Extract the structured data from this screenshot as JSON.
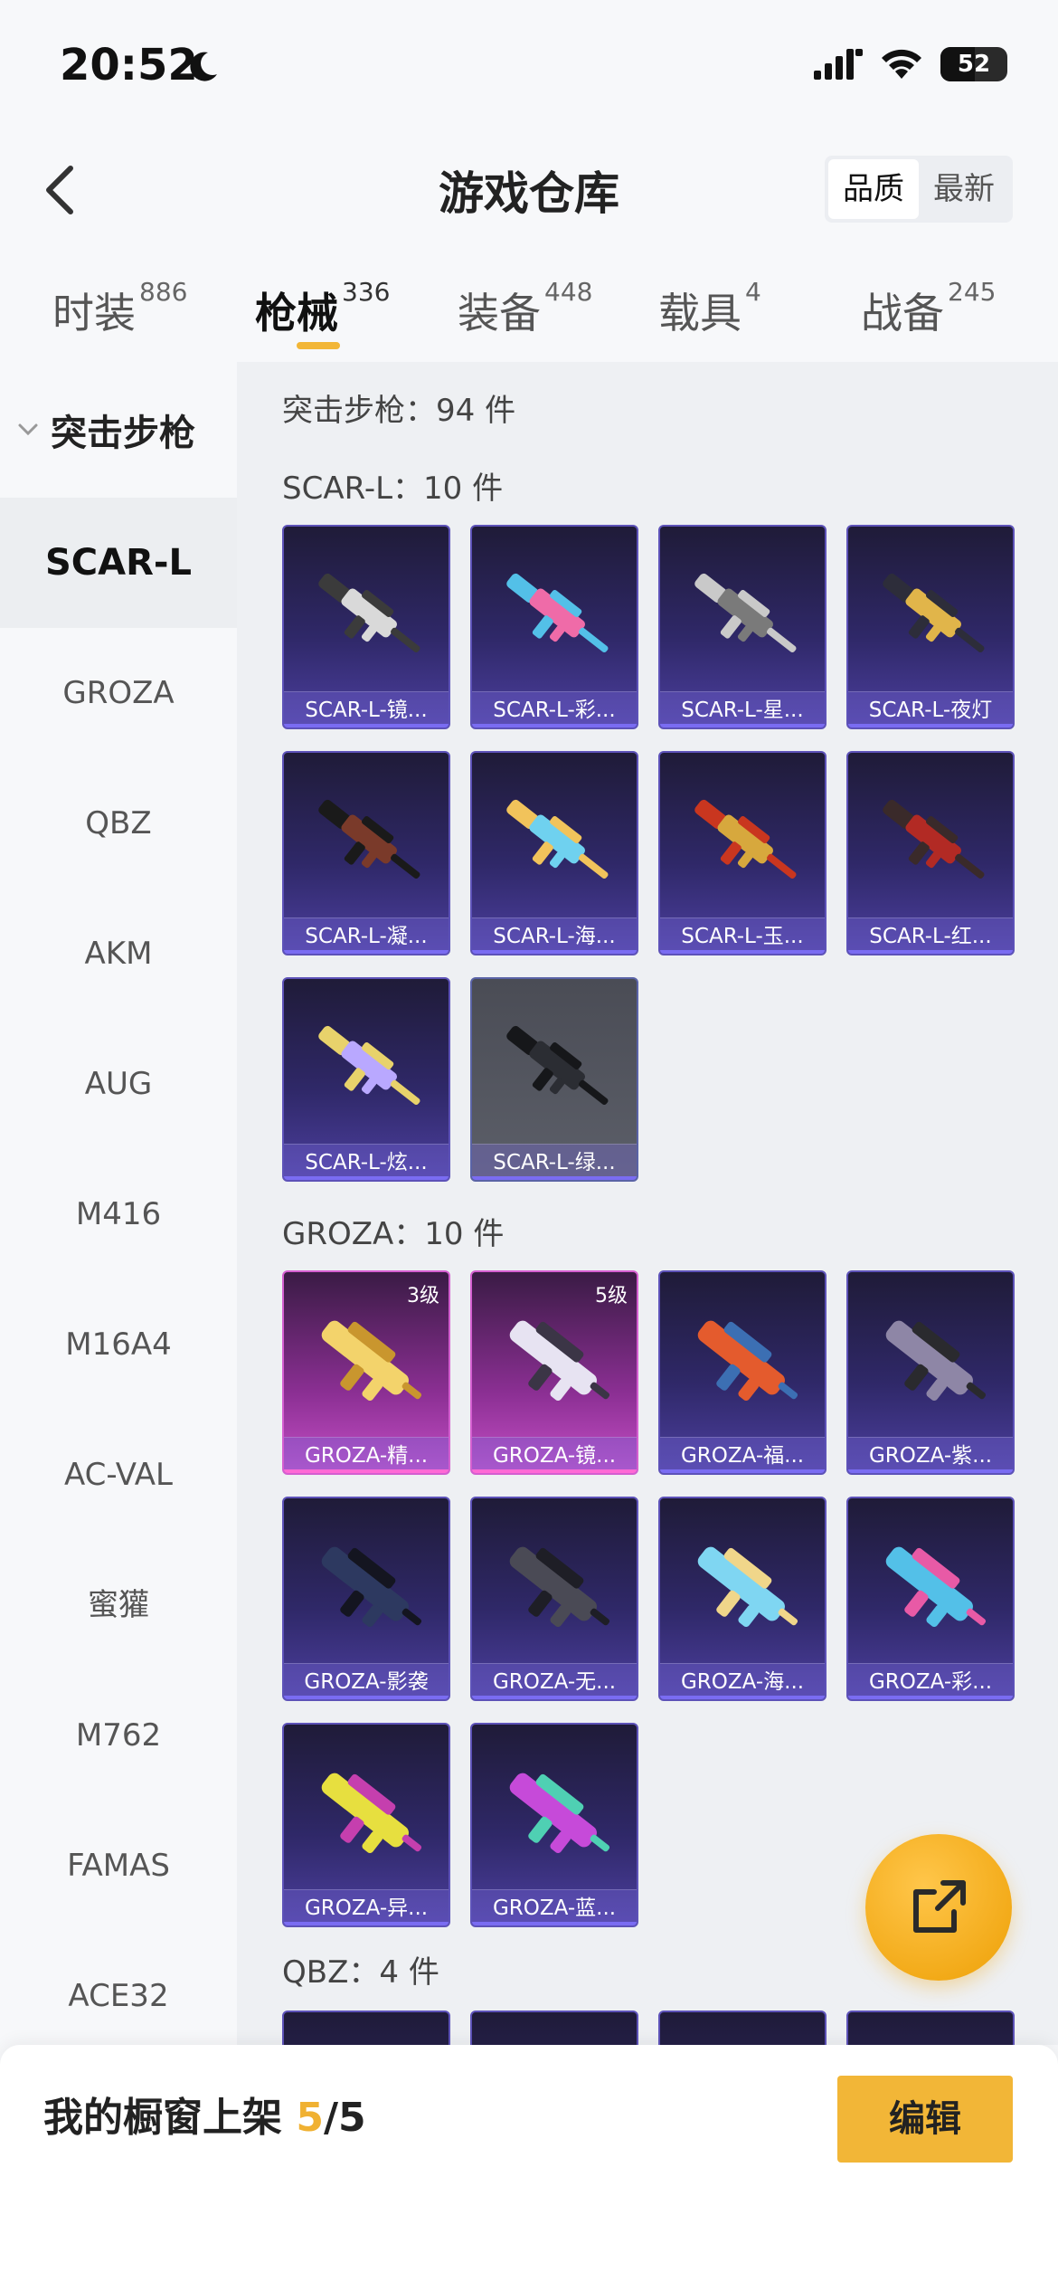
{
  "status_bar": {
    "time": "20:52",
    "battery": "52"
  },
  "header": {
    "title": "游戏仓库",
    "sort_quality": "品质",
    "sort_newest": "最新"
  },
  "tabs": [
    {
      "label": "时装",
      "count": "886"
    },
    {
      "label": "枪械",
      "count": "336"
    },
    {
      "label": "装备",
      "count": "448"
    },
    {
      "label": "载具",
      "count": "4"
    },
    {
      "label": "战备",
      "count": "245"
    }
  ],
  "sidebar": {
    "category": "突击步枪",
    "items": [
      "SCAR-L",
      "GROZA",
      "QBZ",
      "AKM",
      "AUG",
      "M416",
      "M16A4",
      "AC-VAL",
      "蜜獾",
      "M762",
      "FAMAS",
      "ACE32"
    ]
  },
  "main": {
    "section_total": "突击步枪：94 件",
    "groups": [
      {
        "title": "SCAR-L：10 件",
        "items": [
          {
            "name": "SCAR-L-镜...",
            "style": "purple",
            "colors": [
              "#d9d9d9",
              "#3b3b3b"
            ]
          },
          {
            "name": "SCAR-L-彩...",
            "style": "purple",
            "colors": [
              "#ef6ba8",
              "#53c0e8"
            ]
          },
          {
            "name": "SCAR-L-星...",
            "style": "purple",
            "colors": [
              "#7a7a7a",
              "#c9c9c9"
            ]
          },
          {
            "name": "SCAR-L-夜灯",
            "style": "purple",
            "colors": [
              "#e1b54a",
              "#2d2d3a"
            ]
          },
          {
            "name": "SCAR-L-凝...",
            "style": "purple",
            "colors": [
              "#7a3a2a",
              "#1a1a1a"
            ]
          },
          {
            "name": "SCAR-L-海...",
            "style": "purple",
            "colors": [
              "#6fd1ef",
              "#f1c35b"
            ]
          },
          {
            "name": "SCAR-L-玉...",
            "style": "purple",
            "colors": [
              "#d7a83d",
              "#c9361f"
            ]
          },
          {
            "name": "SCAR-L-红...",
            "style": "purple",
            "colors": [
              "#b22a24",
              "#3a2a2a"
            ]
          },
          {
            "name": "SCAR-L-炫...",
            "style": "purple",
            "colors": [
              "#b9a8ff",
              "#e8d26b"
            ]
          },
          {
            "name": "SCAR-L-绿...",
            "style": "gray",
            "colors": [
              "#2b2d33",
              "#16171a"
            ]
          }
        ]
      },
      {
        "title": "GROZA：10 件",
        "items": [
          {
            "name": "GROZA-精...",
            "style": "pink",
            "level": "3级",
            "colors": [
              "#f3d36b",
              "#c9962e"
            ]
          },
          {
            "name": "GROZA-镜...",
            "style": "pink",
            "level": "5级",
            "colors": [
              "#e7e3f2",
              "#3b3546"
            ]
          },
          {
            "name": "GROZA-福...",
            "style": "purple",
            "colors": [
              "#e45b2d",
              "#3c6fb3"
            ]
          },
          {
            "name": "GROZA-紫...",
            "style": "purple",
            "colors": [
              "#8e86a6",
              "#2a2a2e"
            ]
          },
          {
            "name": "GROZA-影袭",
            "style": "purple",
            "colors": [
              "#2d3960",
              "#141520"
            ]
          },
          {
            "name": "GROZA-无...",
            "style": "purple",
            "colors": [
              "#4a4a55",
              "#1e1e26"
            ]
          },
          {
            "name": "GROZA-海...",
            "style": "purple",
            "colors": [
              "#7fd6f2",
              "#f0d68a"
            ]
          },
          {
            "name": "GROZA-彩...",
            "style": "purple",
            "colors": [
              "#53c0e8",
              "#e85aa6"
            ]
          },
          {
            "name": "GROZA-异...",
            "style": "purple",
            "colors": [
              "#e7df3f",
              "#c53fae"
            ]
          },
          {
            "name": "GROZA-蓝...",
            "style": "purple",
            "colors": [
              "#c64ad9",
              "#4fd0b3"
            ]
          }
        ]
      },
      {
        "title": "QBZ：4 件",
        "items": []
      }
    ]
  },
  "bottom": {
    "shop_label": "我的橱窗上架 ",
    "shop_count": "5",
    "shop_total": "/5",
    "edit": "编辑"
  }
}
